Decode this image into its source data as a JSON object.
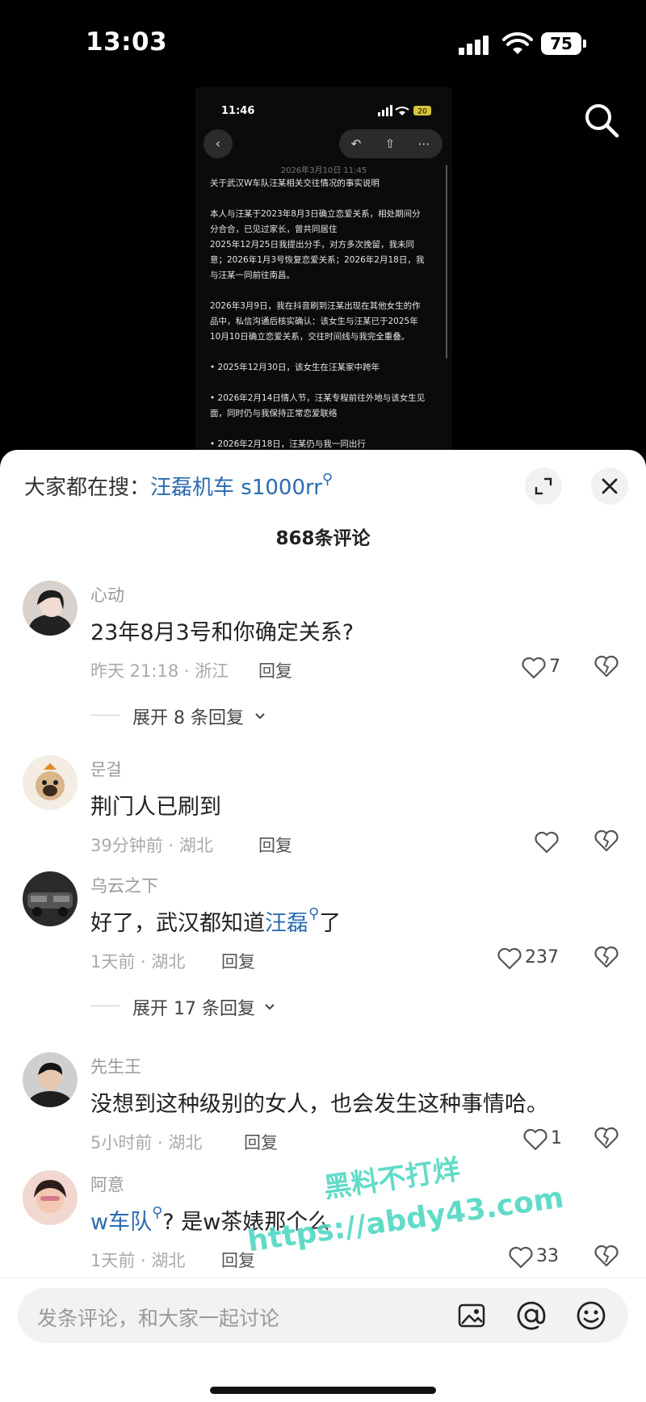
{
  "status_bar": {
    "time": "13:03",
    "battery": "75"
  },
  "video": {
    "inner_time": "11:46",
    "inner_battery": "20",
    "date_line": "2026年3月10日 11:45",
    "paragraphs": [
      "关于武汉W车队汪某相关交往情况的事实说明",
      "本人与汪某于2023年8月3日确立恋爱关系，相处期间分分合合，已见过家长，曾共同居住\n2025年12月25日我提出分手，对方多次挽留，我未同意；2026年1月3号恢复恋爱关系；2026年2月18日，我与汪某一同前往南昌。",
      "2026年3月9日，我在抖音刷到汪某出现在其他女生的作品中，私信沟通后核实确认：该女生与汪某已于2025年10月10日确立恋爱关系，交往时间线与我完全重叠。",
      "• 2025年12月30日，该女生在汪某家中跨年",
      "• 2026年2月14日情人节，汪某专程前往外地与该女生见面，同时仍与我保持正常恋爱联络",
      "• 2026年2月18日，汪某仍与我一同出行"
    ]
  },
  "sheet": {
    "hot_search_prefix": "大家都在搜：",
    "hot_search_keyword": "汪磊机车 s1000rr",
    "comment_count": "868条评论",
    "comments": [
      {
        "user": "心动",
        "text": "23年8月3号和你确定关系?",
        "meta": "昨天 21:18 · 浙江",
        "reply": "回复",
        "likes": "7",
        "expand": "展开 8 条回复"
      },
      {
        "user": "문걸",
        "text": "荆门人已刷到",
        "meta": "39分钟前 · 湖北",
        "reply": "回复",
        "likes": ""
      },
      {
        "user": "乌云之下",
        "text_before": "好了，武汉都知道",
        "text_kw": "汪磊",
        "text_after": "了",
        "meta": "1天前 · 湖北",
        "reply": "回复",
        "likes": "237",
        "expand": "展开 17 条回复"
      },
      {
        "user": "先生王",
        "text": "没想到这种级别的女人，也会发生这种事情哈。",
        "meta": "5小时前 · 湖北",
        "reply": "回复",
        "likes": "1"
      },
      {
        "user": "阿意",
        "text_kw": "w车队",
        "text_after": "? 是w茶婊那个么",
        "meta": "1天前 · 湖北",
        "reply": "回复",
        "likes": "33"
      }
    ],
    "input_placeholder": "发条评论，和大家一起讨论"
  },
  "watermark": {
    "line1": "黑料不打烊",
    "line2": "https://abdy43.com"
  },
  "colors": {
    "keyword": "#2b6cb0",
    "watermark": "#51d8c3",
    "background": "#000000",
    "sheet": "#ffffff"
  }
}
